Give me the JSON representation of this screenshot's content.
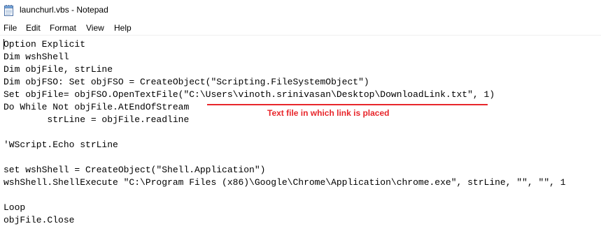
{
  "window": {
    "title": "launchurl.vbs - Notepad"
  },
  "menubar": {
    "file": "File",
    "edit": "Edit",
    "format": "Format",
    "view": "View",
    "help": "Help"
  },
  "editor": {
    "lines": [
      "Option Explicit",
      "Dim wshShell",
      "Dim objFile, strLine",
      "Dim objFSO: Set objFSO = CreateObject(\"Scripting.FileSystemObject\")",
      "Set objFile= objFSO.OpenTextFile(\"C:\\Users\\vinoth.srinivasan\\Desktop\\DownloadLink.txt\", 1)",
      "Do While Not objFile.AtEndOfStream",
      "        strLine = objFile.readline",
      "",
      "'WScript.Echo strLine",
      "",
      "set wshShell = CreateObject(\"Shell.Application\")",
      "wshShell.ShellExecute \"C:\\Program Files (x86)\\Google\\Chrome\\Application\\chrome.exe\", strLine, \"\", \"\", 1",
      "",
      "Loop",
      "objFile.Close"
    ]
  },
  "annotation": {
    "text": "Text file in which link is placed",
    "color": "#e8262b"
  },
  "icons": {
    "app": "notepad-icon"
  }
}
